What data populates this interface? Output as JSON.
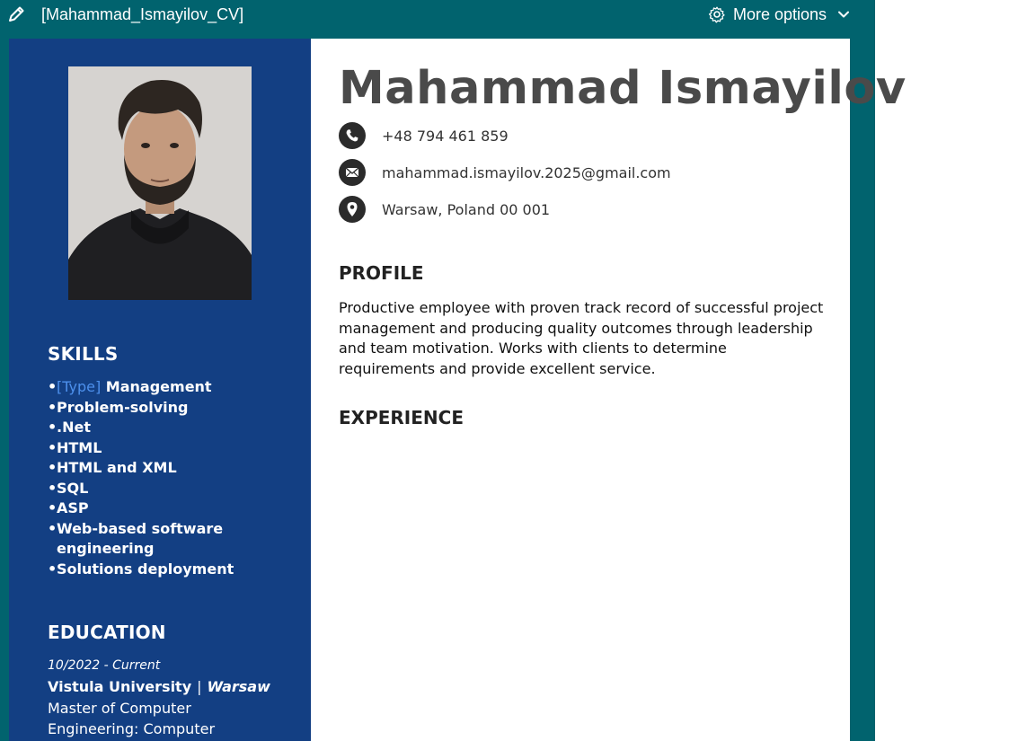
{
  "header": {
    "doc_title": "[Mahammad_Ismayilov_CV]",
    "more_options_label": "More options"
  },
  "resume": {
    "name": "Mahammad Ismayilov",
    "contact": {
      "phone": "+48 794 461 859",
      "email": "mahammad.ismayilov.2025@gmail.com",
      "address": "Warsaw, Poland 00 001"
    },
    "profile_heading": "PROFILE",
    "profile_text": "Productive employee with proven track record of successful project management and producing quality outcomes through leadership and team motivation. Works with clients to determine requirements and provide excellent service.",
    "experience_heading": "EXPERIENCE"
  },
  "sidebar": {
    "skills_heading": "SKILLS",
    "skill_placeholder": "[Type]",
    "skill_first_rest": " Management",
    "skills": [
      "Problem-solving",
      ".Net",
      "HTML",
      "HTML and XML",
      "SQL",
      "ASP",
      "Web-based software engineering",
      "Solutions deployment"
    ],
    "education_heading": "EDUCATION",
    "education": {
      "dates": "10/2022 - Current",
      "school": "Vistula University",
      "separator": "|",
      "city": "Warsaw",
      "degree": "Master of Computer Engineering: Computer"
    }
  },
  "colors": {
    "frame_teal": "#01636e",
    "sidebar_blue": "#133f83",
    "placeholder_blue": "#4d90ec",
    "name_gray": "#4a4a4a"
  },
  "icons": [
    "pencil-icon",
    "gear-icon",
    "chevron-down-icon",
    "phone-icon",
    "email-icon",
    "location-icon"
  ]
}
